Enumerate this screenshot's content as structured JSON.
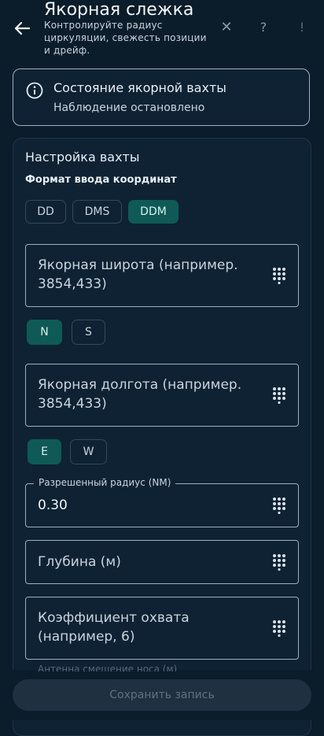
{
  "header": {
    "title": "Якорная слежка",
    "subtitle": "Контролируйте радиус циркуляции, свежесть позиции и дрейф."
  },
  "status": {
    "title": "Состояние якорной вахты",
    "text": "Наблюдение остановлено"
  },
  "settings": {
    "title": "Настройка вахты",
    "format_label": "Формат ввода координат",
    "formats": [
      "DD",
      "DMS",
      "DDM"
    ],
    "selected_format": "DDM",
    "latitude_placeholder": "Якорная широта (например. 3854,433)",
    "lat_hemispheres": [
      "N",
      "S"
    ],
    "selected_lat": "N",
    "longitude_placeholder": "Якорная долгота (например. 3854,433)",
    "lon_hemispheres": [
      "E",
      "W"
    ],
    "selected_lon": "E",
    "radius_label": "Разрешенный радиус (NM)",
    "radius_value": "0.30",
    "depth_placeholder": "Глубина (м)",
    "scope_placeholder": "Коэффициент охвата (например, 6)",
    "peek_label": "Антенна смещение носа (м)"
  },
  "footer": {
    "save_label": "Сохранить запись"
  },
  "colors": {
    "background": "#0b1c2a",
    "accent": "#0f5a56",
    "border": "#9fb0bf"
  }
}
